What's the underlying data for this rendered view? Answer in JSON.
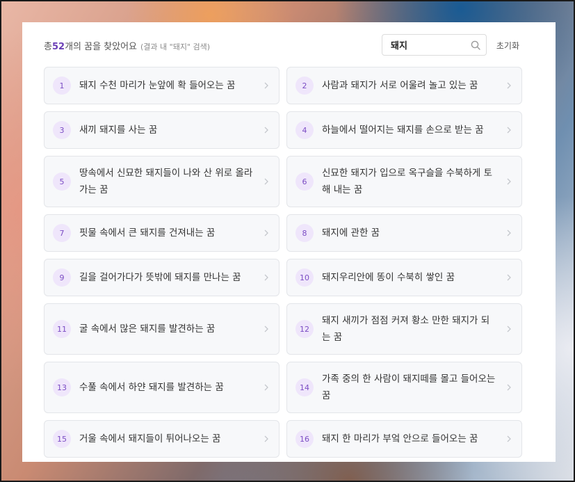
{
  "header": {
    "prefix": "총 ",
    "count": "52",
    "suffix": "개의 꿈을 찾았어요",
    "note": "(결과 내 \"돼지\" 검색)"
  },
  "search": {
    "value": "돼지",
    "icon": "search-icon"
  },
  "reset_label": "초기화",
  "items": [
    {
      "num": "1",
      "title": "돼지 수천 마리가 눈앞에 확 들어오는 꿈"
    },
    {
      "num": "2",
      "title": "사람과 돼지가 서로 어울려 놀고 있는 꿈"
    },
    {
      "num": "3",
      "title": "새끼 돼지를 사는 꿈"
    },
    {
      "num": "4",
      "title": "하늘에서 떨어지는 돼지를 손으로 받는 꿈"
    },
    {
      "num": "5",
      "title": "땅속에서 신묘한 돼지들이 나와 산 위로 올라가는 꿈"
    },
    {
      "num": "6",
      "title": "신묘한 돼지가 입으로 옥구슬을 수북하게 토해 내는 꿈"
    },
    {
      "num": "7",
      "title": "핏물 속에서 큰 돼지를 건져내는 꿈"
    },
    {
      "num": "8",
      "title": "돼지에 관한 꿈"
    },
    {
      "num": "9",
      "title": "길을 걸어가다가 뜻밖에 돼지를 만나는 꿈"
    },
    {
      "num": "10",
      "title": "돼지우리안에 똥이 수북히 쌓인 꿈"
    },
    {
      "num": "11",
      "title": "굴 속에서 많은 돼지를 발견하는 꿈"
    },
    {
      "num": "12",
      "title": "돼지 새끼가 점점 커져 황소 만한 돼지가 되는 꿈"
    },
    {
      "num": "13",
      "title": "수풀 속에서 하얀 돼지를 발견하는 꿈"
    },
    {
      "num": "14",
      "title": "가족 중의 한 사람이 돼지떼를 몰고 들어오는 꿈"
    },
    {
      "num": "15",
      "title": "거울 속에서 돼지들이 튀어나오는 꿈"
    },
    {
      "num": "16",
      "title": "돼지 한 마리가 부엌 안으로 들어오는 꿈"
    }
  ]
}
